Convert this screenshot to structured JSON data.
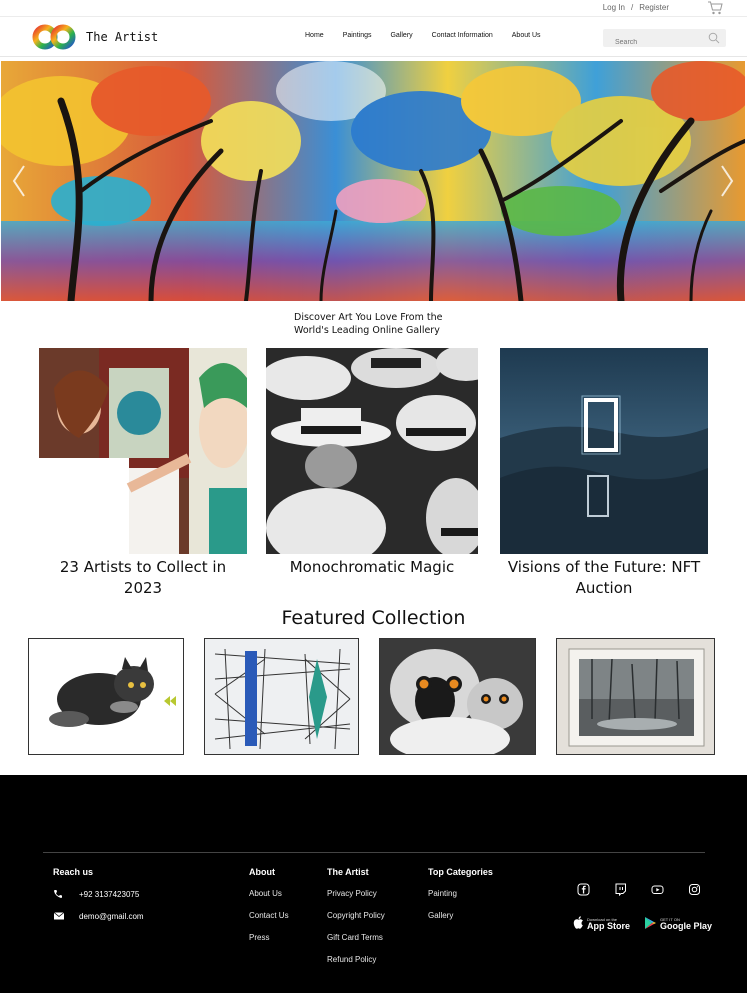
{
  "topbar": {
    "login": "Log In",
    "separator": "/",
    "register": "Register"
  },
  "header": {
    "brand": "The Artist",
    "nav": [
      "Home",
      "Paintings",
      "Gallery",
      "Contact Information",
      "About Us"
    ],
    "search_placeholder": "Search"
  },
  "tagline": {
    "line1": "Discover Art You Love From the",
    "line2": "World's Leading Online Gallery"
  },
  "cards": [
    {
      "caption": "23 Artists to Collect in 2023"
    },
    {
      "caption": "Monochromatic Magic"
    },
    {
      "caption": "Visions of the Future: NFT Auction"
    }
  ],
  "featured": {
    "title": "Featured Collection"
  },
  "footer": {
    "reach": {
      "title": "Reach us",
      "phone": "+92 3137423075",
      "email": "demo@gmail.com"
    },
    "about": {
      "title": "About",
      "items": [
        "About Us",
        "Contact Us",
        "Press"
      ]
    },
    "artist": {
      "title": "The Artist",
      "items": [
        "Privacy Policy",
        "Copyright Policy",
        "Gift Card Terms",
        "Refund Policy"
      ]
    },
    "categories": {
      "title": "Top Categories",
      "items": [
        "Painting",
        "Gallery"
      ]
    },
    "appstore": {
      "small": "Download on the",
      "big": "App Store"
    },
    "googleplay": {
      "small": "GET IT ON",
      "big": "Google Play"
    }
  }
}
